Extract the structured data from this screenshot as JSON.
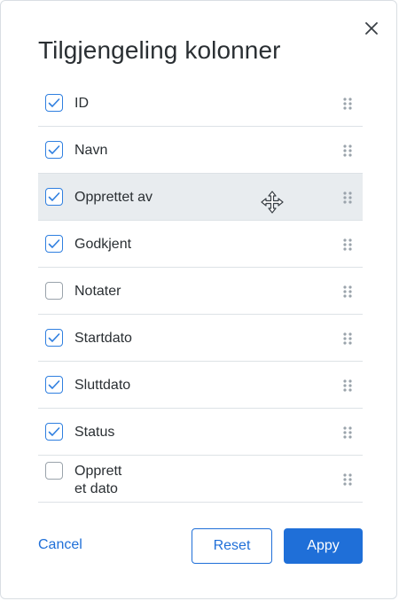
{
  "dialog": {
    "title": "Tilgjengeling kolonner",
    "close_icon": "close-icon"
  },
  "columns": [
    {
      "label": "ID",
      "checked": true
    },
    {
      "label": "Navn",
      "checked": true
    },
    {
      "label": "Opprettet av",
      "checked": true,
      "hovered": true
    },
    {
      "label": "Godkjent",
      "checked": true
    },
    {
      "label": "Notater",
      "checked": false
    },
    {
      "label": "Startdato",
      "checked": true
    },
    {
      "label": "Sluttdato",
      "checked": true
    },
    {
      "label": "Status",
      "checked": true
    },
    {
      "label": "Opprett et dato",
      "checked": false
    }
  ],
  "footer": {
    "cancel_label": "Cancel",
    "reset_label": "Reset",
    "apply_label": "Appy"
  },
  "colors": {
    "accent": "#1f6fd8",
    "hover_row": "#e8ecef",
    "divider": "#dde2e6",
    "text": "#2a2f33"
  }
}
